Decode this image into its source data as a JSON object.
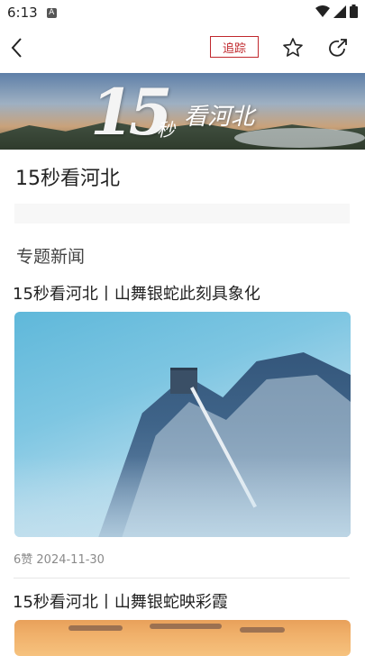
{
  "status": {
    "time": "6:13",
    "notif_icon": "A"
  },
  "toolbar": {
    "track_label": "追踪"
  },
  "banner": {
    "number": "15",
    "sec": "秒",
    "title": "看河北"
  },
  "page": {
    "title": "15秒看河北",
    "section": "专题新闻"
  },
  "articles": [
    {
      "title": "15秒看河北丨山舞银蛇此刻具象化",
      "meta": "6赞  2024-11-30"
    },
    {
      "title": "15秒看河北丨山舞银蛇映彩霞"
    }
  ],
  "icons": [
    "back-arrow-icon",
    "star-icon",
    "share-icon",
    "wifi-icon",
    "signal-icon",
    "battery-icon"
  ],
  "colors": {
    "accent": "#c0282d",
    "meta": "#8a8a8a"
  }
}
